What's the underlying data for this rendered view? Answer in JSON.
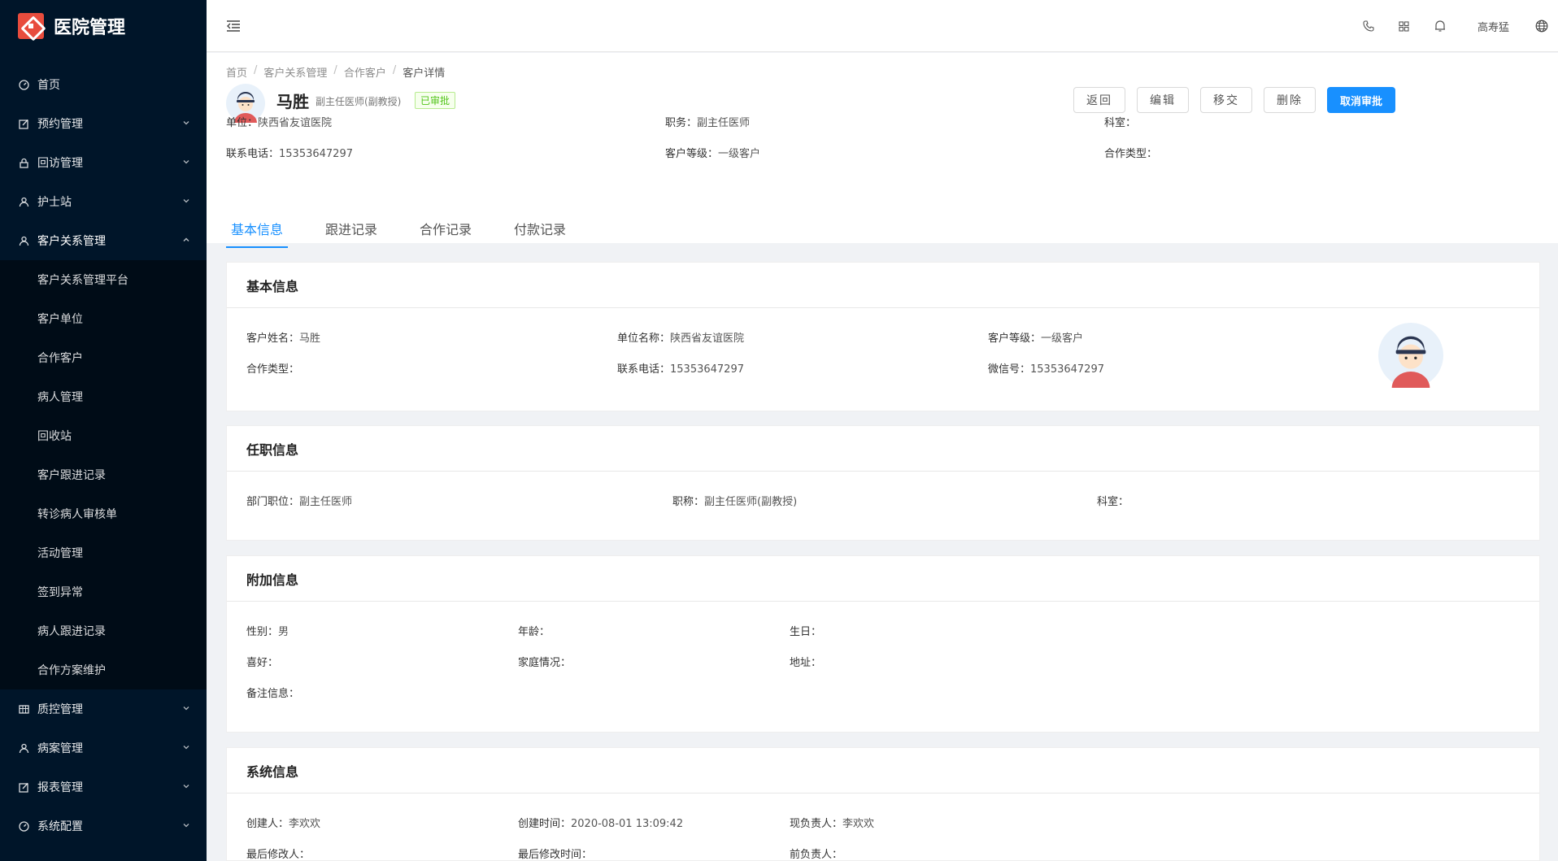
{
  "app": {
    "title": "医院管理"
  },
  "sidebar": {
    "items": [
      {
        "label": "首页",
        "icon": "dashboard-icon",
        "has_children": false
      },
      {
        "label": "预约管理",
        "icon": "edit-icon",
        "has_children": true
      },
      {
        "label": "回访管理",
        "icon": "lock-icon",
        "has_children": true
      },
      {
        "label": "护士站",
        "icon": "user-icon",
        "has_children": true
      },
      {
        "label": "客户关系管理",
        "icon": "user-icon",
        "has_children": true,
        "open": true
      }
    ],
    "sub_items": [
      "客户关系管理平台",
      "客户单位",
      "合作客户",
      "病人管理",
      "回收站",
      "客户跟进记录",
      "转诊病人审核单",
      "活动管理",
      "签到异常",
      "病人跟进记录",
      "合作方案维护"
    ],
    "items_after": [
      {
        "label": "质控管理",
        "icon": "table-icon",
        "has_children": true
      },
      {
        "label": "病案管理",
        "icon": "user-icon",
        "has_children": true
      },
      {
        "label": "报表管理",
        "icon": "edit-icon",
        "has_children": true
      },
      {
        "label": "系统配置",
        "icon": "dashboard-icon",
        "has_children": true
      }
    ]
  },
  "header": {
    "user": "高寿猛"
  },
  "breadcrumb": [
    "首页",
    "客户关系管理",
    "合作客户",
    "客户详情"
  ],
  "person": {
    "name": "马胜",
    "title": "副主任医师(副教授)",
    "status": "已审批"
  },
  "actions": {
    "back": "返回",
    "edit": "编辑",
    "transfer": "移交",
    "delete": "删除",
    "cancel_approval": "取消审批"
  },
  "meta": {
    "row1": [
      {
        "k": "单位：",
        "v": "陕西省友谊医院"
      },
      {
        "k": "职务：",
        "v": "副主任医师"
      },
      {
        "k": "科室：",
        "v": ""
      }
    ],
    "row2": [
      {
        "k": "联系电话：",
        "v": "15353647297"
      },
      {
        "k": "客户等级：",
        "v": "一级客户"
      },
      {
        "k": "合作类型：",
        "v": ""
      }
    ]
  },
  "tabs": [
    "基本信息",
    "跟进记录",
    "合作记录",
    "付款记录"
  ],
  "basic": {
    "title": "基本信息",
    "fields": [
      {
        "k": "客户姓名：",
        "v": "马胜"
      },
      {
        "k": "单位名称：",
        "v": "陕西省友谊医院"
      },
      {
        "k": "客户等级：",
        "v": "一级客户"
      },
      {
        "k": "合作类型：",
        "v": ""
      },
      {
        "k": "联系电话：",
        "v": "15353647297"
      },
      {
        "k": "微信号：",
        "v": "15353647297"
      }
    ]
  },
  "job": {
    "title": "任职信息",
    "fields": [
      {
        "k": "部门职位：",
        "v": "副主任医师"
      },
      {
        "k": "职称：",
        "v": "副主任医师(副教授)"
      },
      {
        "k": "科室：",
        "v": ""
      }
    ]
  },
  "extra": {
    "title": "附加信息",
    "fields": [
      {
        "k": "性别：",
        "v": "男"
      },
      {
        "k": "年龄：",
        "v": ""
      },
      {
        "k": "生日：",
        "v": ""
      },
      {
        "k": "喜好：",
        "v": ""
      },
      {
        "k": "家庭情况：",
        "v": ""
      },
      {
        "k": "地址：",
        "v": ""
      },
      {
        "k": "备注信息：",
        "v": ""
      }
    ]
  },
  "system": {
    "title": "系统信息",
    "fields": [
      {
        "k": "创建人：",
        "v": "李欢欢"
      },
      {
        "k": "创建时间：",
        "v": "2020-08-01 13:09:42"
      },
      {
        "k": "现负责人：",
        "v": "李欢欢"
      },
      {
        "k": "最后修改人：",
        "v": ""
      },
      {
        "k": "最后修改时间：",
        "v": ""
      },
      {
        "k": "前负责人：",
        "v": ""
      }
    ]
  },
  "colors": {
    "primary": "#1890ff",
    "sidebar_bg": "#001529",
    "success": "#52c41a",
    "logo": "#e84c3d"
  }
}
